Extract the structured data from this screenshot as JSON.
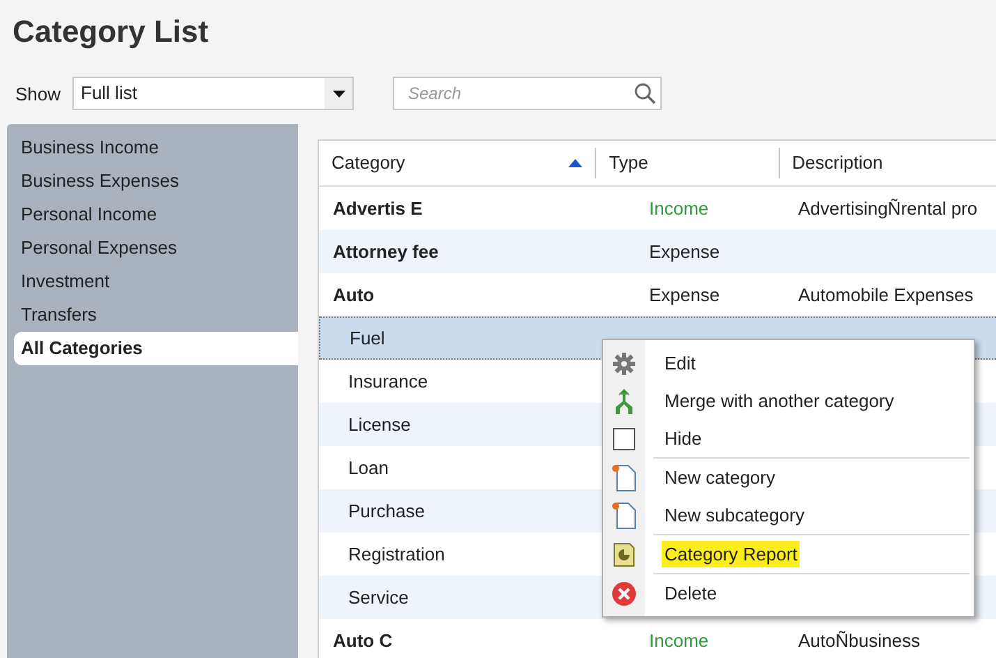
{
  "title": "Category List",
  "show": {
    "label": "Show",
    "value": "Full list"
  },
  "search": {
    "placeholder": "Search"
  },
  "sidebar": {
    "items": [
      {
        "label": "Business Income",
        "selected": false
      },
      {
        "label": "Business Expenses",
        "selected": false
      },
      {
        "label": "Personal Income",
        "selected": false
      },
      {
        "label": "Personal Expenses",
        "selected": false
      },
      {
        "label": "Investment",
        "selected": false
      },
      {
        "label": "Transfers",
        "selected": false
      },
      {
        "label": "All Categories",
        "selected": true
      }
    ]
  },
  "table": {
    "columns": [
      {
        "label": "Category",
        "sorted": true
      },
      {
        "label": "Type",
        "sorted": false
      },
      {
        "label": "Description",
        "sorted": false
      }
    ],
    "rows": [
      {
        "category": "Advertis E",
        "type": "Income",
        "color": "#2f9a3a",
        "description": "AdvertisingÑrental pro",
        "selected": false
      },
      {
        "category": "Attorney fee",
        "type": "Expense",
        "color": "#222222",
        "selected": false
      },
      {
        "category": "Auto",
        "type": "Expense",
        "color": "#222222",
        "description": "Automobile Expenses",
        "selected": false,
        "children": [
          {
            "category": "Fuel",
            "selected": true
          },
          {
            "category": "Insurance",
            "selected": false
          },
          {
            "category": "License",
            "selected": false
          },
          {
            "category": "Loan",
            "selected": false
          },
          {
            "category": "Purchase",
            "selected": false
          },
          {
            "category": "Registration",
            "selected": false
          },
          {
            "category": "Service",
            "selected": false
          }
        ]
      },
      {
        "category": "Auto C",
        "type": "Income",
        "color": "#2f9a3a",
        "description": "AutoÑbusiness",
        "selected": false
      }
    ]
  },
  "context_menu": {
    "items": [
      {
        "label": "Edit",
        "kind": "edit",
        "separator_before": false,
        "highlighted": false
      },
      {
        "label": "Merge with another category",
        "kind": "merge",
        "separator_before": false,
        "highlighted": false
      },
      {
        "label": "Hide",
        "kind": "hide",
        "separator_before": false,
        "highlighted": false
      },
      {
        "label": "New category",
        "kind": "new",
        "separator_before": true,
        "highlighted": false
      },
      {
        "label": "New subcategory",
        "kind": "new",
        "separator_before": false,
        "highlighted": false
      },
      {
        "label": "Category Report",
        "kind": "report",
        "separator_before": true,
        "highlighted": true
      },
      {
        "label": "Delete",
        "kind": "delete",
        "separator_before": true,
        "highlighted": false
      }
    ]
  }
}
